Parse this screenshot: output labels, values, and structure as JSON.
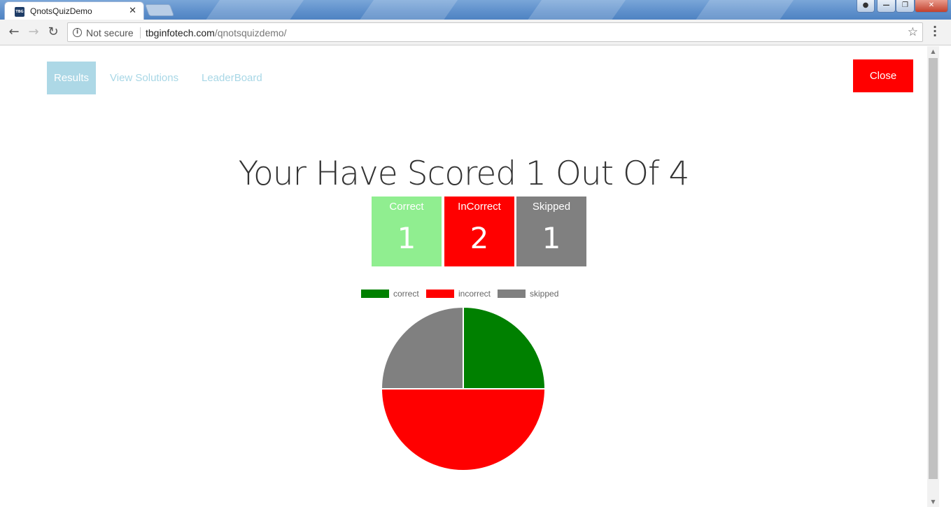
{
  "browser": {
    "tab_title": "QnotsQuizDemo",
    "tab_close": "✕",
    "security_label": "Not secure",
    "url_host": "tbginfotech.com",
    "url_path": "/qnotsquizdemo/"
  },
  "nav": {
    "tabs": [
      {
        "label": "Results"
      },
      {
        "label": "View Solutions"
      },
      {
        "label": "LeaderBoard"
      }
    ],
    "close_label": "Close"
  },
  "score": {
    "title": "Your Have Scored 1 Out Of 4"
  },
  "stats": [
    {
      "label": "Correct",
      "value": "1",
      "color": "#90ee90"
    },
    {
      "label": "InCorrect",
      "value": "2",
      "color": "#ff0000"
    },
    {
      "label": "Skipped",
      "value": "1",
      "color": "#808080"
    }
  ],
  "chart_data": {
    "type": "pie",
    "categories": [
      "correct",
      "incorrect",
      "skipped"
    ],
    "values": [
      1,
      2,
      1
    ],
    "colors": [
      "#008000",
      "#ff0000",
      "#808080"
    ],
    "legend": "top"
  }
}
